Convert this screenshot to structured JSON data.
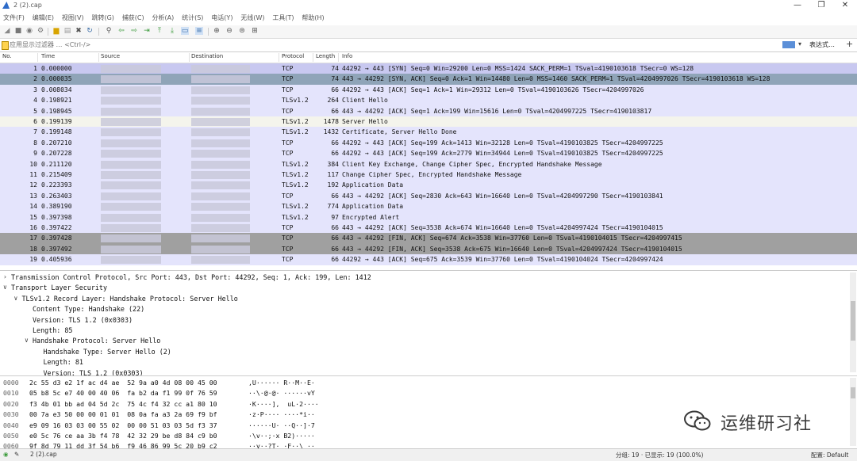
{
  "window": {
    "title": "2 (2).cap",
    "controls": [
      "—",
      "❐",
      "✕"
    ]
  },
  "menu": [
    "文件(F)",
    "编辑(E)",
    "视图(V)",
    "跳转(G)",
    "捕获(C)",
    "分析(A)",
    "统计(S)",
    "电话(Y)",
    "无线(W)",
    "工具(T)",
    "帮助(H)"
  ],
  "filter": {
    "placeholder": "应用显示过滤器 … <Ctrl-/>",
    "dropdown": "▾",
    "expression_label": "表达式…",
    "add": "+"
  },
  "packet_list": {
    "columns": [
      "No.",
      "Time",
      "Source",
      "Destination",
      "Protocol",
      "Length",
      "Info"
    ],
    "rows": [
      {
        "no": "1",
        "time": "0.000000",
        "protocol": "TCP",
        "length": "74",
        "info": "44292 → 443 [SYN] Seq=0 Win=29200 Len=0 MSS=1424 SACK_PERM=1 TSval=4190103618 TSecr=0 WS=128",
        "bg": "#c8c8f0"
      },
      {
        "no": "2",
        "time": "0.000035",
        "protocol": "TCP",
        "length": "74",
        "info": "443 → 44292 [SYN, ACK] Seq=0 Ack=1 Win=14480 Len=0 MSS=1460 SACK_PERM=1 TSval=4204997026 TSecr=4190103618 WS=128",
        "bg": "#8fa4b8"
      },
      {
        "no": "3",
        "time": "0.008034",
        "protocol": "TCP",
        "length": "66",
        "info": "44292 → 443 [ACK] Seq=1 Ack=1 Win=29312 Len=0 TSval=4190103626 TSecr=4204997026",
        "bg": "#e4e4fc"
      },
      {
        "no": "4",
        "time": "0.198921",
        "protocol": "TLSv1.2",
        "length": "264",
        "info": "Client Hello",
        "bg": "#e4e4fc"
      },
      {
        "no": "5",
        "time": "0.198945",
        "protocol": "TCP",
        "length": "66",
        "info": "443 → 44292 [ACK] Seq=1 Ack=199 Win=15616 Len=0 TSval=4204997225 TSecr=4190103817",
        "bg": "#e4e4fc"
      },
      {
        "no": "6",
        "time": "0.199139",
        "protocol": "TLSv1.2",
        "length": "1478",
        "info": "Server Hello",
        "bg": "#f4f4ec"
      },
      {
        "no": "7",
        "time": "0.199148",
        "protocol": "TLSv1.2",
        "length": "1432",
        "info": "Certificate, Server Hello Done",
        "bg": "#e4e4fc"
      },
      {
        "no": "8",
        "time": "0.207210",
        "protocol": "TCP",
        "length": "66",
        "info": "44292 → 443 [ACK] Seq=199 Ack=1413 Win=32128 Len=0 TSval=4190103825 TSecr=4204997225",
        "bg": "#e4e4fc"
      },
      {
        "no": "9",
        "time": "0.207228",
        "protocol": "TCP",
        "length": "66",
        "info": "44292 → 443 [ACK] Seq=199 Ack=2779 Win=34944 Len=0 TSval=4190103825 TSecr=4204997225",
        "bg": "#e4e4fc"
      },
      {
        "no": "10",
        "time": "0.211120",
        "protocol": "TLSv1.2",
        "length": "384",
        "info": "Client Key Exchange, Change Cipher Spec, Encrypted Handshake Message",
        "bg": "#e4e4fc"
      },
      {
        "no": "11",
        "time": "0.215409",
        "protocol": "TLSv1.2",
        "length": "117",
        "info": "Change Cipher Spec, Encrypted Handshake Message",
        "bg": "#e4e4fc"
      },
      {
        "no": "12",
        "time": "0.223393",
        "protocol": "TLSv1.2",
        "length": "192",
        "info": "Application Data",
        "bg": "#e4e4fc"
      },
      {
        "no": "13",
        "time": "0.263403",
        "protocol": "TCP",
        "length": "66",
        "info": "443 → 44292 [ACK] Seq=2830 Ack=643 Win=16640 Len=0 TSval=4204997290 TSecr=4190103841",
        "bg": "#e4e4fc"
      },
      {
        "no": "14",
        "time": "0.389190",
        "protocol": "TLSv1.2",
        "length": "774",
        "info": "Application Data",
        "bg": "#e4e4fc"
      },
      {
        "no": "15",
        "time": "0.397398",
        "protocol": "TLSv1.2",
        "length": "97",
        "info": "Encrypted Alert",
        "bg": "#e4e4fc"
      },
      {
        "no": "16",
        "time": "0.397422",
        "protocol": "TCP",
        "length": "66",
        "info": "443 → 44292 [ACK] Seq=3538 Ack=674 Win=16640 Len=0 TSval=4204997424 TSecr=4190104015",
        "bg": "#e4e4fc"
      },
      {
        "no": "17",
        "time": "0.397428",
        "protocol": "TCP",
        "length": "66",
        "info": "443 → 44292 [FIN, ACK] Seq=674 Ack=3538 Win=37760 Len=0 TSval=4190104015 TSecr=4204997415",
        "bg": "#a0a0a0"
      },
      {
        "no": "18",
        "time": "0.397492",
        "protocol": "TCP",
        "length": "66",
        "info": "443 → 44292 [FIN, ACK] Seq=3538 Ack=675 Win=16640 Len=0 TSval=4204997424 TSecr=4190104015",
        "bg": "#a0a0a0"
      },
      {
        "no": "19",
        "time": "0.405936",
        "protocol": "TCP",
        "length": "66",
        "info": "44292 → 443 [ACK] Seq=675 Ack=3539 Win=37760 Len=0 TSval=4190104024 TSecr=4204997424",
        "bg": "#e4e4fc"
      }
    ]
  },
  "details": [
    {
      "indent": 0,
      "toggle": "›",
      "text": "Transmission Control Protocol, Src Port: 443, Dst Port: 44292, Seq: 1, Ack: 199, Len: 1412"
    },
    {
      "indent": 0,
      "toggle": "∨",
      "text": "Transport Layer Security"
    },
    {
      "indent": 1,
      "toggle": "∨",
      "text": "TLSv1.2 Record Layer: Handshake Protocol: Server Hello"
    },
    {
      "indent": 2,
      "toggle": "",
      "text": "Content Type: Handshake (22)"
    },
    {
      "indent": 2,
      "toggle": "",
      "text": "Version: TLS 1.2 (0x0303)"
    },
    {
      "indent": 2,
      "toggle": "",
      "text": "Length: 85"
    },
    {
      "indent": 2,
      "toggle": "∨",
      "text": "Handshake Protocol: Server Hello"
    },
    {
      "indent": 3,
      "toggle": "",
      "text": "Handshake Type: Server Hello (2)"
    },
    {
      "indent": 3,
      "toggle": "",
      "text": "Length: 81"
    },
    {
      "indent": 3,
      "toggle": "",
      "text": "Version: TLS 1.2 (0x0303)"
    }
  ],
  "bytes": [
    {
      "offset": "0000",
      "hex": "2c 55 d3 e2 1f ac d4 ae  52 9a a0 4d 08 00 45 00",
      "ascii": ",U······ R··M··E·"
    },
    {
      "offset": "0010",
      "hex": "05 b8 5c e7 40 00 40 06  fa b2 da f1 99 0f 76 59",
      "ascii": "··\\·@·@· ······vY"
    },
    {
      "offset": "0020",
      "hex": "f3 4b 01 bb ad 04 5d 2c  75 4c f4 32 cc a1 80 10",
      "ascii": "·K····],  uL·2····"
    },
    {
      "offset": "0030",
      "hex": "00 7a e3 50 00 00 01 01  08 0a fa a3 2a 69 f9 bf",
      "ascii": "·z·P···· ····*i··"
    },
    {
      "offset": "0040",
      "hex": "e9 09 16 03 03 00 55 02  00 00 51 03 03 5d f3 37",
      "ascii": "······U· ··Q··]·7"
    },
    {
      "offset": "0050",
      "hex": "e0 5c 76 ce aa 3b f4 78  42 32 29 be d8 84 c9 b0",
      "ascii": "·\\v··;·x B2)·····"
    },
    {
      "offset": "0060",
      "hex": "9f 8d 79 11 dd 3f 54 b6  f9 46 86 99 5c 20 b9 c2",
      "ascii": "··y··?T· ·F··\\ ··"
    }
  ],
  "watermark": "运维研习社",
  "status": {
    "file": "2 (2).cap",
    "packets": "分组: 19 · 已显示: 19 (100.0%)",
    "profile": "配置: Default"
  },
  "colors": {
    "tcp_row": "#e4e4fc",
    "syn_row": "#c8c8f0",
    "selected_dark": "#8fa4b8",
    "fin_row": "#a0a0a0",
    "selected_row": "#f4f4ec"
  }
}
